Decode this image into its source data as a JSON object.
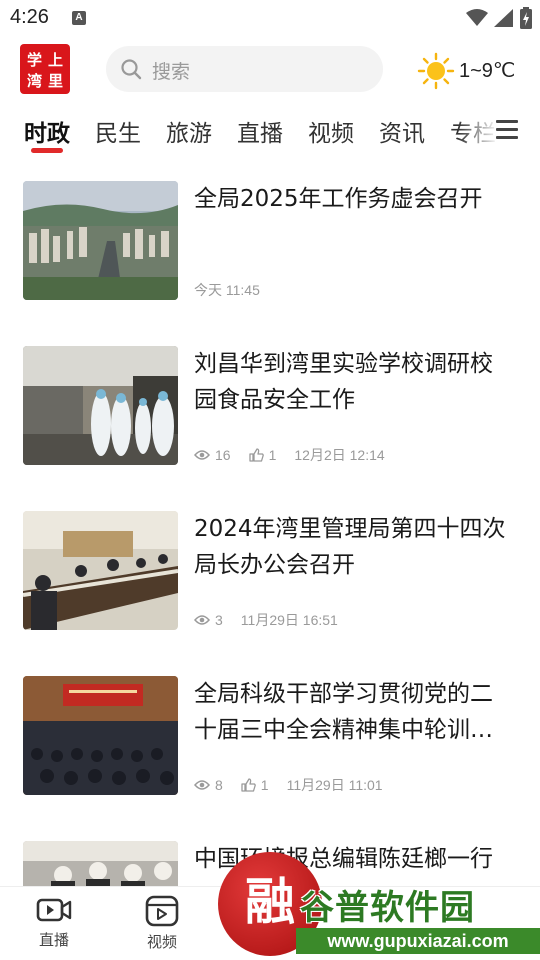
{
  "status": {
    "time": "4:26",
    "a_badge": "A"
  },
  "header": {
    "logo_chars": [
      "学",
      "上",
      "湾",
      "里"
    ],
    "search_placeholder": "搜索",
    "weather_temp": "1~9℃"
  },
  "tabs": [
    {
      "label": "时政",
      "active": true
    },
    {
      "label": "民生",
      "active": false
    },
    {
      "label": "旅游",
      "active": false
    },
    {
      "label": "直播",
      "active": false
    },
    {
      "label": "视频",
      "active": false
    },
    {
      "label": "资讯",
      "active": false
    },
    {
      "label": "专栏",
      "active": false
    }
  ],
  "news": [
    {
      "title": "全局2025年工作务虚会召开",
      "time": "今天 11:45"
    },
    {
      "title": "刘昌华到湾里实验学校调研校园食品安全工作",
      "views": "16",
      "likes": "1",
      "time": "12月2日 12:14"
    },
    {
      "title": "2024年湾里管理局第四十四次局长办公会召开",
      "views": "3",
      "time": "11月29日 16:51"
    },
    {
      "title": "全局科级干部学习贯彻党的二十届三中全会精神集中轮训…",
      "views": "8",
      "likes": "1",
      "time": "11月29日 11:01"
    },
    {
      "title": "中国环境报总编辑陈廷榔一行"
    }
  ],
  "bottom_nav": [
    {
      "label": "直播",
      "icon": "live-camera-icon"
    },
    {
      "label": "视频",
      "icon": "video-play-icon"
    }
  ],
  "watermark": {
    "circle_char": "融",
    "title": "谷普软件园",
    "url": "www.gupuxiazai.com"
  },
  "colors": {
    "accent": "#e12a2a",
    "logo_bg": "#d9161b",
    "meta_gray": "#9a9a9a",
    "watermark_green": "#2d7a23"
  }
}
